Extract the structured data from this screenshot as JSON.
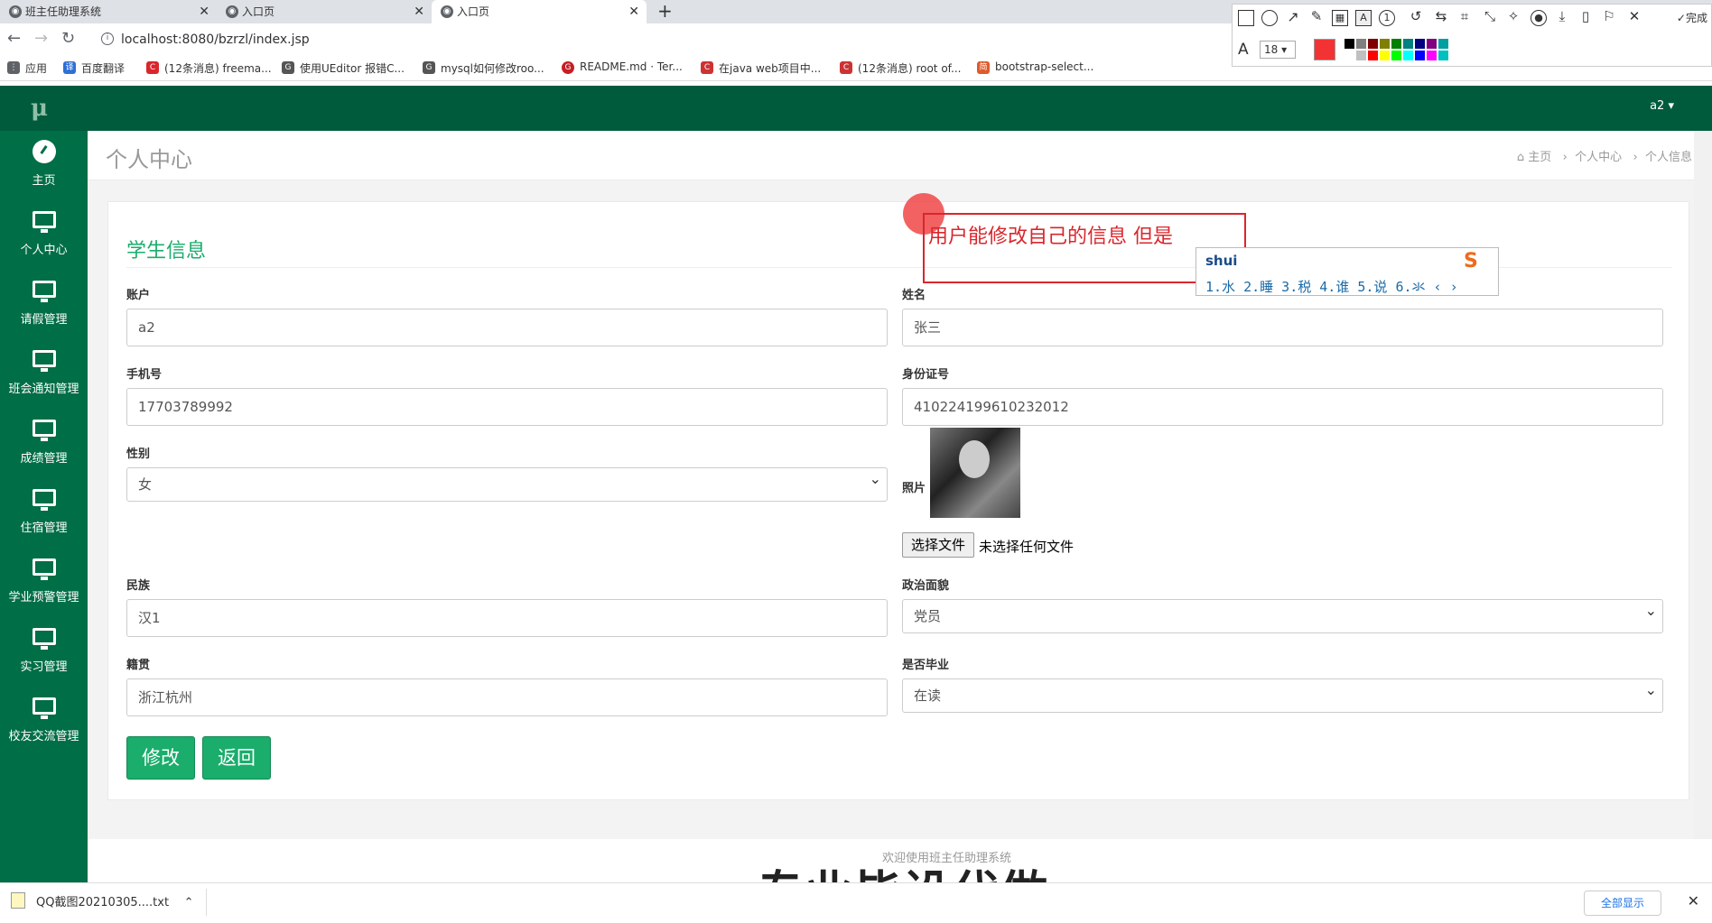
{
  "browser": {
    "tabs": [
      {
        "label": "班主任助理系统",
        "active": false
      },
      {
        "label": "入口页",
        "active": false
      },
      {
        "label": "入口页",
        "active": true
      }
    ],
    "new_tab": "+",
    "url": "localhost:8080/bzrzl/index.jsp",
    "bookmarks": [
      "应用",
      "百度翻译",
      "(12条消息) freema...",
      "使用UEditor 报错C...",
      "mysql如何修改roo...",
      "README.md · Ter...",
      "在java web项目中...",
      "(12条消息) root of...",
      "bootstrap-select..."
    ]
  },
  "qq_toolbar": {
    "done_label": "完成",
    "font_size": "18",
    "current_color": "#f33333",
    "palette": [
      "#000000",
      "#808080",
      "#800000",
      "#808000",
      "#008000",
      "#008080",
      "#000080",
      "#800080",
      "#00a0a0",
      "#ffffff",
      "#c0c0c0",
      "#ff0000",
      "#ffff00",
      "#00ff00",
      "#00ffff",
      "#0000ff",
      "#ff00ff",
      "#00c0c0"
    ]
  },
  "app": {
    "user": "a2 ▾",
    "sidebar": [
      {
        "label": "主页",
        "icon": "dashboard-icon"
      },
      {
        "label": "个人中心",
        "icon": "monitor-icon"
      },
      {
        "label": "请假管理",
        "icon": "monitor-icon"
      },
      {
        "label": "班会通知管理",
        "icon": "monitor-icon"
      },
      {
        "label": "成绩管理",
        "icon": "monitor-icon"
      },
      {
        "label": "住宿管理",
        "icon": "monitor-icon"
      },
      {
        "label": "学业预警管理",
        "icon": "monitor-icon"
      },
      {
        "label": "实习管理",
        "icon": "monitor-icon"
      },
      {
        "label": "校友交流管理",
        "icon": "monitor-icon"
      }
    ],
    "page_title": "个人中心",
    "breadcrumb": [
      "主页",
      "个人中心",
      "个人信息"
    ],
    "card_title": "学生信息",
    "form": {
      "account": {
        "label": "账户",
        "value": "a2"
      },
      "name": {
        "label": "姓名",
        "value": "张三"
      },
      "phone": {
        "label": "手机号",
        "value": "17703789992"
      },
      "idcard": {
        "label": "身份证号",
        "value": "410224199610232012"
      },
      "gender": {
        "label": "性别",
        "value": "女"
      },
      "photo": {
        "label": "照片",
        "file_button": "选择文件",
        "file_status": "未选择任何文件"
      },
      "ethnic": {
        "label": "民族",
        "value": "汉1"
      },
      "politics": {
        "label": "政治面貌",
        "value": "党员"
      },
      "hometown": {
        "label": "籍贯",
        "value": "浙江杭州"
      },
      "graduated": {
        "label": "是否毕业",
        "value": "在读"
      }
    },
    "buttons": {
      "edit": "修改",
      "back": "返回"
    },
    "footer": "欢迎使用班主任助理系统"
  },
  "annotation": {
    "text": "用户能修改自己的信息 但是",
    "ime_input": "shui",
    "ime_candidates": "1.水  2.睡  3.税  4.谁  5.说  6.氺  ‹ ›"
  },
  "watermark": "专业毕设代做",
  "download_bar": {
    "file": "QQ截图20210305....txt",
    "show_all": "全部显示"
  }
}
